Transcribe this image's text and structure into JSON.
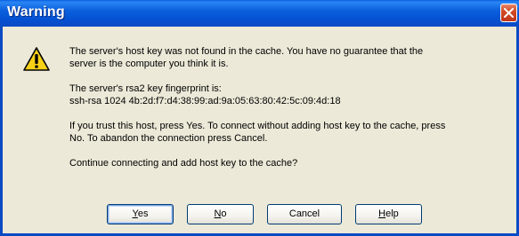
{
  "window": {
    "title": "Warning",
    "close_icon": "close-icon"
  },
  "dialog": {
    "icon": "warning-icon",
    "line1a": "The server's host key was not found in the cache. You have no guarantee that the",
    "line1b": "server is the computer you think it is.",
    "line2a": "The server's rsa2 key fingerprint is:",
    "line2b": "ssh-rsa 1024 4b:2d:f7:d4:38:99:ad:9a:05:63:80:42:5c:09:4d:18",
    "line3a": "If you trust this host, press Yes. To connect without adding host key to the cache, press",
    "line3b": "No. To abandon the connection press Cancel.",
    "line4": "Continue connecting and add host key to the cache?"
  },
  "buttons": {
    "yes_mnemonic": "Y",
    "yes_rest": "es",
    "no_mnemonic": "N",
    "no_rest": "o",
    "cancel": "Cancel",
    "help_mnemonic": "H",
    "help_rest": "elp"
  },
  "colors": {
    "titlebar": "#0553d4",
    "dialog_bg": "#ece9d8",
    "close_button": "#d24a24",
    "warning_yellow": "#f7d117"
  }
}
